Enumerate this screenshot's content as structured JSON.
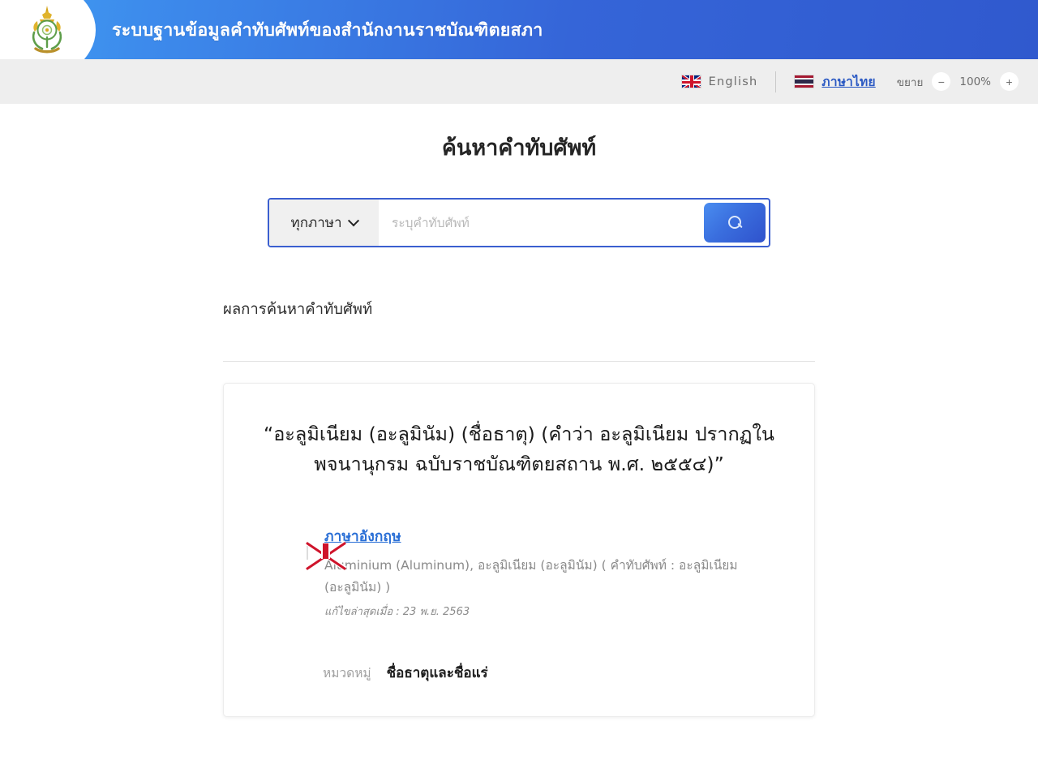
{
  "header": {
    "title": "ระบบฐานข้อมูลคำทับศัพท์ของสำนักงานราชบัณฑิตยสภา",
    "logo_icon": "royal-society-emblem"
  },
  "lang_bar": {
    "english": {
      "label": "English",
      "flag_icon": "uk-flag-icon"
    },
    "thai": {
      "label": "ภาษาไทย",
      "flag_icon": "thai-flag-icon",
      "active": true
    },
    "zoom": {
      "label": "ขยาย",
      "decrease_icon": "minus-icon",
      "decrease_label": "−",
      "percent": "100%",
      "increase_icon": "plus-icon",
      "increase_label": "+"
    }
  },
  "main": {
    "page_title": "ค้นหาคำทับศัพท์",
    "search": {
      "language_filter": "ทุกภาษา",
      "dropdown_icon": "chevron-down-icon",
      "placeholder": "ระบุคำทับศัพท์",
      "value": "",
      "search_icon": "search-icon"
    },
    "results_heading": "ผลการค้นหาคำทับศัพท์",
    "result": {
      "entry_title": "“อะลูมิเนียม (อะลูมินัม) (ชื่อธาตุ) (คำว่า อะลูมิเนียม ปรากฏในพจนานุกรม ฉบับราชบัณฑิตยสถาน พ.ศ. ๒๕๕๔)”",
      "language_link": "ภาษาอังกฤษ",
      "flag_icon": "uk-flag-icon",
      "definition": "Aluminium (Aluminum), อะลูมิเนียม (อะลูมินัม) ( คำทับศัพท์ : อะลูมิเนียม (อะลูมินัม) )",
      "updated": "แก้ไขล่าสุดเมื่อ : 23 พ.ย. 2563",
      "category_label": "หมวดหมู่",
      "category_value": "ชื่อธาตุและชื่อแร่"
    }
  },
  "colors": {
    "header_blue_light": "#3f9df1",
    "header_blue_dark": "#3059ce",
    "link_blue": "#2a6fd6",
    "search_border": "#3b5fd0",
    "lang_bar_bg": "#eeeeee"
  }
}
